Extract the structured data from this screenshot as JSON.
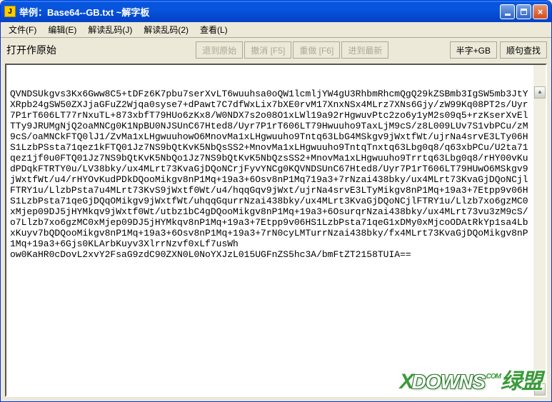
{
  "title": "举例：Base64--GB.txt  ~解字板",
  "menu": {
    "file": "文件(F)",
    "edit": "编辑(E)",
    "decode1": "解读乱码(J)",
    "decode2": "解读乱码(2)",
    "view": "查看(L)"
  },
  "toolbar": {
    "label": "打开作原始",
    "back": "退到原始",
    "undo": "撤消 [F5]",
    "redo": "重做 [F6]",
    "forward": "进到最新",
    "mode": "半字+GB",
    "search": "顺句查找"
  },
  "content": "QVNDSUkgvs3Kx6Gww8C5+tDFz6K7pbu7serXvLT6wuuhsa0oQW1lcmljYW4gU3RhbmRhcmQgQ29kZSBmb3IgSW5mb3JtYXRpb24gSW50ZXJjaGFuZ2Wjqa0syse7+dPawt7C7dfWxLix7bXE0rvM17XnxNSx4MLrz7XNs6Gjy/zW99Kq08PT2s/Uyr7P1rT606LT77rNxuTL+873xbfT79HUo6zKx8/W0NDX7s2o08O1xLWl19a92rHgwuvPtc2zo6y1yM2s09q5+rzKserXvElTTy9JRUMgNjQ2oaMNCg0K1NpBU0NJSUnC67Hted8/Uyr7P1rT606LT79Hwuuho9TaxLjM9cS/z8L009LUv7S1vbPCu/zM9cS/oaMNCkFTQ0lJ1/ZvMa1xLHgwuuhowO6MnovMa1xLHgwuuho9Tntq63LbG4MSkgv9jWxtfWt/ujrNa4srvE3LTy06HS1LzbPSsta71qez1kFTQ01Jz7NS9bQtKvK5NbQsSS2+MnovMa1xLHgwuuho9TntqTnxtq63Lbg0q8/q63xbPCu/U2ta71qez1jf0u0FTQ01Jz7NS9bQtKvK5NbQo1Jz7NS9bQtKvK5NbQzsSS2+MnovMa1xLHgwuuho9Trrtq63Lbg0q8/rHY00vKudPDqkFTRTY0u/LV38bky/ux4MLrt73KvaGjDQoNCrjFyvYNCg0KQVNDSUnC67Hted8/Uyr7P1rT606LT79HUwO6MSkgv9jWxtfWt/u4/rHYOvKudPDkDQooMikgv8nP1Mq+19a3+6Osv8nP1Mq719a3+7rNzai438bky/ux4MLrt73KvaGjDQoNCjlFTRY1u/LlzbPsta7u4MLrt73KvS9jWxtf0Wt/u4/hqqGqv9jWxt/ujrNa4srvE3LTyMikgv8nP1Mq+19a3+7Etpp9v06HS1LzbPsta71qeGjDQqOMikgv9jWxtfWt/uhqqGqurrNzai438bky/ux4MLrt3KvaGjDQoNCjlFTRY1u/Llzb7xo6gzMC0xMjep09DJ5jHYMkqv9jWxtf0Wt/utbz1bC4gDQooMikgv8nP1Mq+19a3+6OsurqrNzai438bky/ux4MLrt73vu3zM9cS/o7Llzb7xo6gzMC0xMjep09DJ5jHYMkqv8nP1Mq+19a3+7Etpp9v06HS1LzbPsta71qeG1xDMy0xMjcoODAtRkYp1sa4LbxKuyv7bQDQooMikgv8nP1Mq+19a3+6Osv8nP1Mq+19a3+7rN0cyLMTurrNzai438bky/fx4MLrt73KvaGjDQoMikgv8nP1Mq+19a3+6Gjs0KLArbKuyv3XlrrNzvf0xLf7usWh\now0KaHR0cDovL2xvY2FsaG9zdC90ZXN0L0NoYXJzL015UGFnZS5hc3A/bmFtZT2158TUIA==",
  "watermark": {
    "x": "X",
    "downs": "DOWNS",
    "dot": ".COM",
    "cn": "绿盟"
  }
}
